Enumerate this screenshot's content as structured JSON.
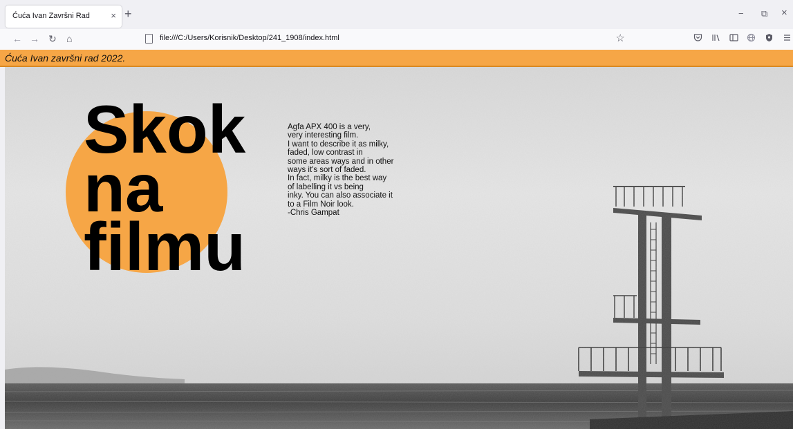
{
  "browser": {
    "tab_title": "Ćuća Ivan Završni Rad",
    "tab_close": "×",
    "new_tab": "+",
    "url": "file:///C:/Users/Korisnik/Desktop/241_1908/index.html",
    "window_controls": {
      "minimize": "−",
      "restore": "⧉",
      "close": "×"
    }
  },
  "page": {
    "header_text": "Ćuća Ivan završni rad 2022.",
    "title_lines": [
      "Skok",
      "na",
      "filmu"
    ],
    "quote_lines": [
      "Agfa APX 400 is a very,",
      "very interesting film.",
      "I want to describe it as milky,",
      "faded, low contrast in",
      "some areas ways and in other",
      "ways it's sort of faded.",
      "In fact, milky is the best way",
      "of labelling it vs being",
      "inky. You can also associate it",
      "to a Film Noir look.",
      "-Chris Gampat"
    ]
  },
  "colors": {
    "accent_orange": "#f6a646",
    "header_border": "#d98922"
  }
}
